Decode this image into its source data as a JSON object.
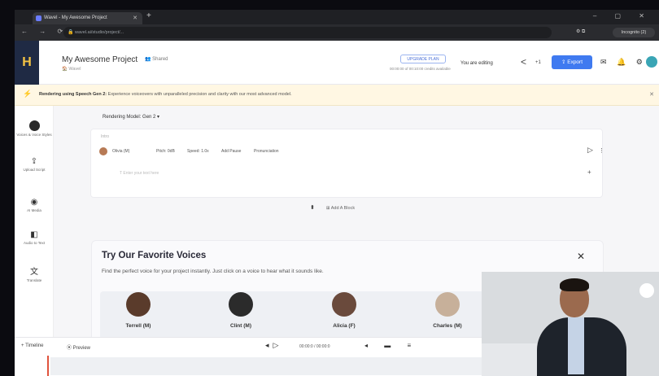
{
  "browser": {
    "tab_title": "Wavel - My Awesome Project",
    "url": "wavel.ai/studio/project/...",
    "profile": "Incognito (2)"
  },
  "header": {
    "project_title": "My Awesome Project",
    "share_label": "Shared",
    "subtitle": "Wavel",
    "upgrade_label": "UPGRADE PLAN",
    "credits": "00:00:00 of 00:10:00 credits available",
    "editing_label": "You are editing",
    "collaborator_count": "+1",
    "export_label": "Export"
  },
  "banner": {
    "bold": "Rendering using Speech Gen 2:",
    "text": "Experience voiceovers with unparalleled precision and clarity with our most advanced model."
  },
  "sidebar": {
    "items": [
      {
        "label": "Voices & Voice Styles",
        "icon": "avatar"
      },
      {
        "label": "Upload Script",
        "icon": "upload-icon"
      },
      {
        "label": "AI Media",
        "icon": "media-icon"
      },
      {
        "label": "Audio to Text",
        "icon": "audio-icon"
      },
      {
        "label": "Translate",
        "icon": "translate-icon"
      }
    ]
  },
  "editor": {
    "model_line": "Rendering Model: Gen 2",
    "block_intro": "Intro",
    "speaker": "Olivia (M)",
    "chips": [
      "Pitch: 0dB",
      "Speed: 1.0x",
      "Add Pause",
      "Pronunciation"
    ],
    "input_placeholder": "Enter your text here",
    "add_block_label": "Add A Block"
  },
  "voices_panel": {
    "title": "Try Our Favorite Voices",
    "description": "Find the perfect voice for your project instantly. Just click on a voice to hear what it sounds like.",
    "voices": [
      {
        "name": "Terrell (M)",
        "color": "#5a3b2b"
      },
      {
        "name": "Clint (M)",
        "color": "#2b2b2b"
      },
      {
        "name": "Alicia (F)",
        "color": "#6a4a3c"
      },
      {
        "name": "Charles (M)",
        "color": "#c7b09a"
      }
    ]
  },
  "timeline": {
    "label": "Timeline",
    "preview_label": "Preview",
    "time": "00:00:0 / 00:00:0"
  }
}
